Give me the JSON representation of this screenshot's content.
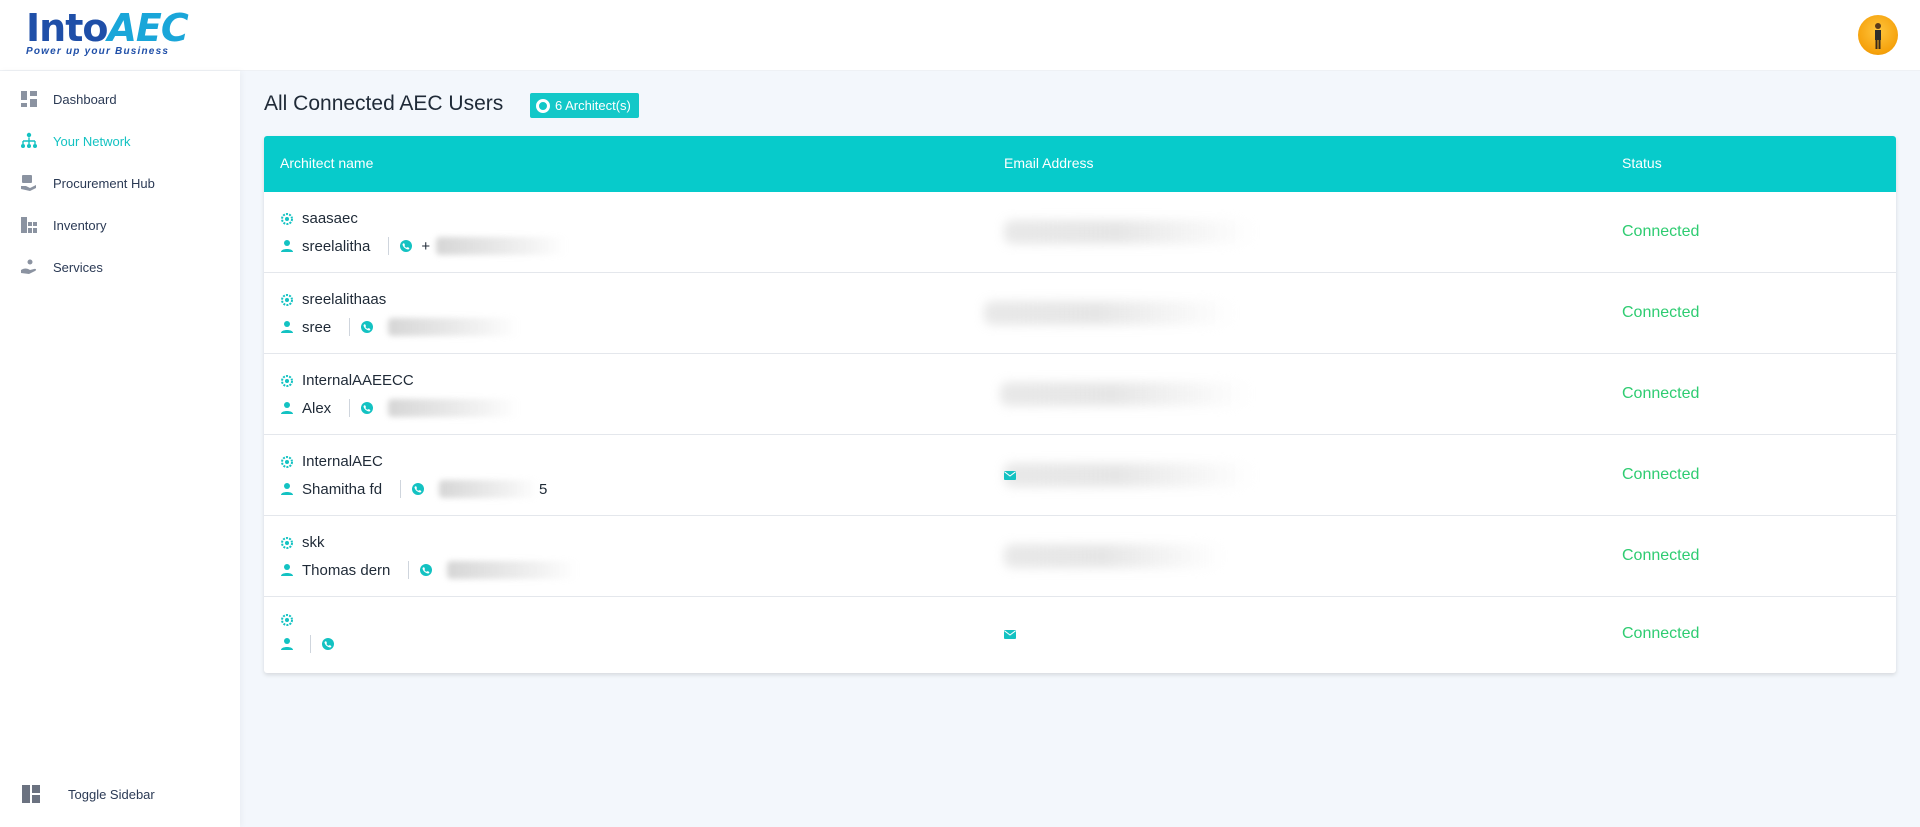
{
  "header": {
    "logo_main": "Into",
    "logo_aec": "AEC",
    "logo_tagline": "Power up your Business"
  },
  "sidebar": {
    "items": [
      {
        "label": "Dashboard",
        "icon": "dashboard-icon",
        "active": false
      },
      {
        "label": "Your Network",
        "icon": "network-icon",
        "active": true
      },
      {
        "label": "Procurement Hub",
        "icon": "procurement-icon",
        "active": false
      },
      {
        "label": "Inventory",
        "icon": "inventory-icon",
        "active": false
      },
      {
        "label": "Services",
        "icon": "services-icon",
        "active": false
      }
    ],
    "toggle_label": "Toggle Sidebar"
  },
  "main": {
    "title": "All Connected AEC Users",
    "badge": "6 Architect(s)"
  },
  "table": {
    "columns": [
      "Architect name",
      "Email Address",
      "Status"
    ],
    "rows": [
      {
        "company": "saasaec",
        "person": "sreelalitha",
        "phone_visible": "+",
        "status": "Connected"
      },
      {
        "company": "sreelalithaas",
        "person": "sree",
        "phone_visible": "",
        "status": "Connected"
      },
      {
        "company": "InternalAAEECC",
        "person": "Alex",
        "phone_visible": "",
        "status": "Connected"
      },
      {
        "company": "InternalAEC",
        "person": "Shamitha fd",
        "phone_visible": "5",
        "status": "Connected"
      },
      {
        "company": "skk",
        "person": "Thomas dern",
        "phone_visible": "",
        "status": "Connected"
      },
      {
        "company": "",
        "person": "",
        "phone_visible": "",
        "status": "Connected"
      }
    ]
  },
  "colors": {
    "accent": "#07cbcb",
    "status_connected": "#2ecc71",
    "brand": "#1f4fa8"
  }
}
